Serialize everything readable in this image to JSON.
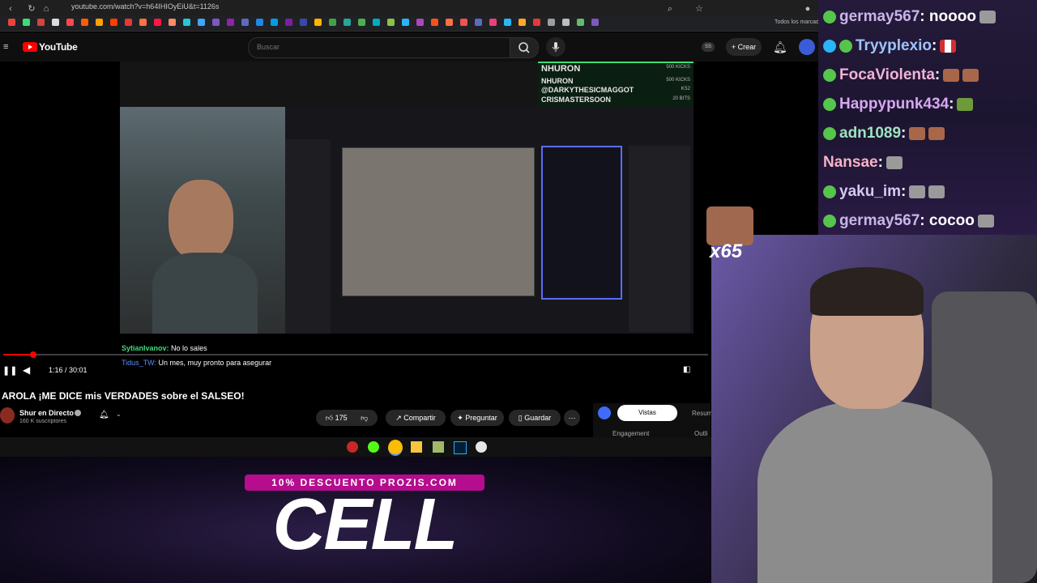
{
  "browser": {
    "url": "youtube.com/watch?v=h64IHIOyEiU&t=1126s",
    "bookmarks_label": "Todos los marcador"
  },
  "youtube": {
    "logo": "YouTube",
    "search_placeholder": "Buscar",
    "create_label": "Crear",
    "avatar_badge": "SS"
  },
  "video": {
    "alert_rows": [
      {
        "name": "NHURON",
        "amount": "500 KICKS"
      },
      {
        "name": "NHURON",
        "amount": "500 KICKS"
      },
      {
        "name": "@DARKYTHESICMAGGOT",
        "amount": "KS2"
      },
      {
        "name": "CRISMASTERSOON",
        "amount": "20 BITS"
      }
    ],
    "overlay_chat": [
      {
        "user": "SytianIvanov:",
        "text": "No lo sales"
      },
      {
        "user": "Tidus_TW:",
        "text": "Un mes, muy pronto para asegurar"
      }
    ],
    "time": "1:16 / 30:01",
    "progress": 0.042
  },
  "video_info": {
    "title": "AROLA ¡ME DICE mis VERDADES sobre el SALSEO!",
    "channel": "Shur en Directo",
    "subscribers": "160 K suscriptores",
    "likes": "175",
    "share_label": "Compartir",
    "ask_label": "Preguntar",
    "save_label": "Guardar"
  },
  "analytics": {
    "tab_vistas": "Vistas",
    "tab_resumen": "Resum",
    "engagement": "Engagement",
    "outline": "Outli"
  },
  "promo": {
    "banner": "10% DESCUENTO PROZIS.COM",
    "big_text": "CELL"
  },
  "stream_chat": [
    {
      "user": "germay567",
      "message": ": noooo",
      "color": "#c7b6e8"
    },
    {
      "user": "Tryyplexio",
      "message": ":",
      "color": "#9ec3ff"
    },
    {
      "user": "FocaViolenta",
      "message": ":",
      "color": "#f0b3d8"
    },
    {
      "user": "Happypunk434",
      "message": ":",
      "color": "#d7a7f0"
    },
    {
      "user": "adn1089",
      "message": ":",
      "color": "#9fe2c0"
    },
    {
      "user": "Nansae",
      "message": ":",
      "color": "#f7b2c7"
    },
    {
      "user": "yaku_im",
      "message": ":",
      "color": "#d8c8f5"
    },
    {
      "user": "germay567",
      "message": ": cocoo",
      "color": "#c7b6e8"
    }
  ],
  "sticker": {
    "label": "x65"
  }
}
